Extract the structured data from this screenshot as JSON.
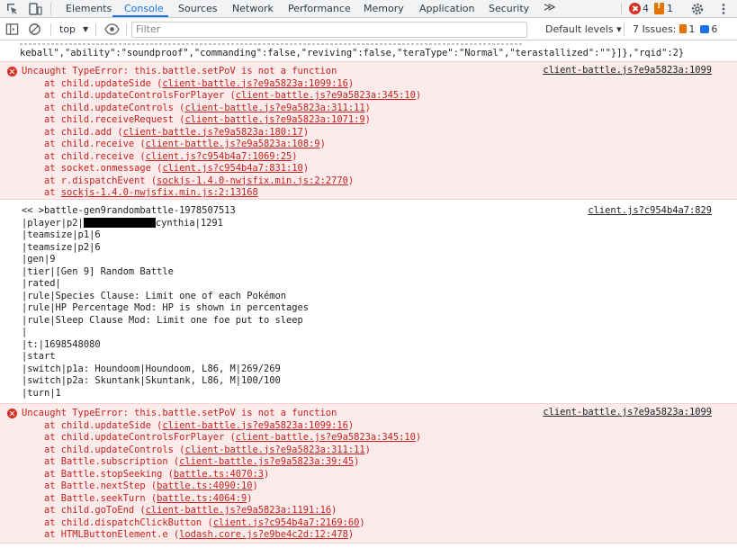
{
  "tabs": [
    {
      "label": "Elements"
    },
    {
      "label": "Console"
    },
    {
      "label": "Sources"
    },
    {
      "label": "Network"
    },
    {
      "label": "Performance"
    },
    {
      "label": "Memory"
    },
    {
      "label": "Application"
    },
    {
      "label": "Security"
    }
  ],
  "more_tabs": "≫",
  "errors_count": "4",
  "warnings_count": "1",
  "toolbar": {
    "context": "top",
    "filter_placeholder": "Filter",
    "levels": "Default levels ▾",
    "issues_label": "7 Issues:",
    "issues_warn": "1",
    "issues_info": "6"
  },
  "console": {
    "fragment": "keball\",\"ability\":\"soundproof\",\"commanding\":false,\"reviving\":false,\"teraType\":\"Normal\",\"terastallized\":\"\"}]},\"rqid\":2}",
    "error1": {
      "message": "Uncaught TypeError: this.battle.setPoV is not a function",
      "source": "client-battle.js?e9a5823a:1099",
      "stack": [
        {
          "fn": "    at child.updateSide ",
          "loc": "client-battle.js?e9a5823a:1099:16"
        },
        {
          "fn": "    at child.updateControlsForPlayer ",
          "loc": "client-battle.js?e9a5823a:345:10"
        },
        {
          "fn": "    at child.updateControls ",
          "loc": "client-battle.js?e9a5823a:311:11"
        },
        {
          "fn": "    at child.receiveRequest ",
          "loc": "client-battle.js?e9a5823a:1071:9"
        },
        {
          "fn": "    at child.add ",
          "loc": "client-battle.js?e9a5823a:180:17"
        },
        {
          "fn": "    at child.receive ",
          "loc": "client-battle.js?e9a5823a:108:9"
        },
        {
          "fn": "    at child.receive ",
          "loc": "client.js?c954b4a7:1069:25"
        },
        {
          "fn": "    at socket.onmessage ",
          "loc": "client.js?c954b4a7:831:10"
        },
        {
          "fn": "    at r.dispatchEvent ",
          "loc": "sockjs-1.4.0-nwjsfix.min.js:2:2770"
        },
        {
          "fn": "    at ",
          "loc": "sockjs-1.4.0-nwjsfix.min.js:2:13168"
        }
      ]
    },
    "log": {
      "source": "client.js?c954b4a7:829",
      "player_prefix": "|player|p2|",
      "player_suffix": "cynthia|1291",
      "lines_before": [
        "<< >battle-gen9randombattle-1978507513"
      ],
      "lines_after": [
        "|teamsize|p1|6",
        "|teamsize|p2|6",
        "|gen|9",
        "|tier|[Gen 9] Random Battle",
        "|rated|",
        "|rule|Species Clause: Limit one of each Pokémon",
        "|rule|HP Percentage Mod: HP is shown in percentages",
        "|rule|Sleep Clause Mod: Limit one foe put to sleep",
        "|",
        "|t:|1698548080",
        "|start",
        "|switch|p1a: Houndoom|Houndoom, L86, M|269/269",
        "|switch|p2a: Skuntank|Skuntank, L86, M|100/100",
        "|turn|1"
      ]
    },
    "error2": {
      "message": "Uncaught TypeError: this.battle.setPoV is not a function",
      "source": "client-battle.js?e9a5823a:1099",
      "stack": [
        {
          "fn": "    at child.updateSide ",
          "loc": "client-battle.js?e9a5823a:1099:16"
        },
        {
          "fn": "    at child.updateControlsForPlayer ",
          "loc": "client-battle.js?e9a5823a:345:10"
        },
        {
          "fn": "    at child.updateControls ",
          "loc": "client-battle.js?e9a5823a:311:11"
        },
        {
          "fn": "    at Battle.subscription ",
          "loc": "client-battle.js?e9a5823a:39:45"
        },
        {
          "fn": "    at Battle.stopSeeking ",
          "loc": "battle.ts:4070:3"
        },
        {
          "fn": "    at Battle.nextStep ",
          "loc": "battle.ts:4090:10"
        },
        {
          "fn": "    at Battle.seekTurn ",
          "loc": "battle.ts:4064:9"
        },
        {
          "fn": "    at child.goToEnd ",
          "loc": "client-battle.js?e9a5823a:1191:16"
        },
        {
          "fn": "    at child.dispatchClickButton ",
          "loc": "client.js?c954b4a7:2169:60"
        },
        {
          "fn": "    at HTMLButtonElement.e ",
          "loc": "lodash.core.js?e9be4c2d:12:478"
        }
      ]
    }
  }
}
